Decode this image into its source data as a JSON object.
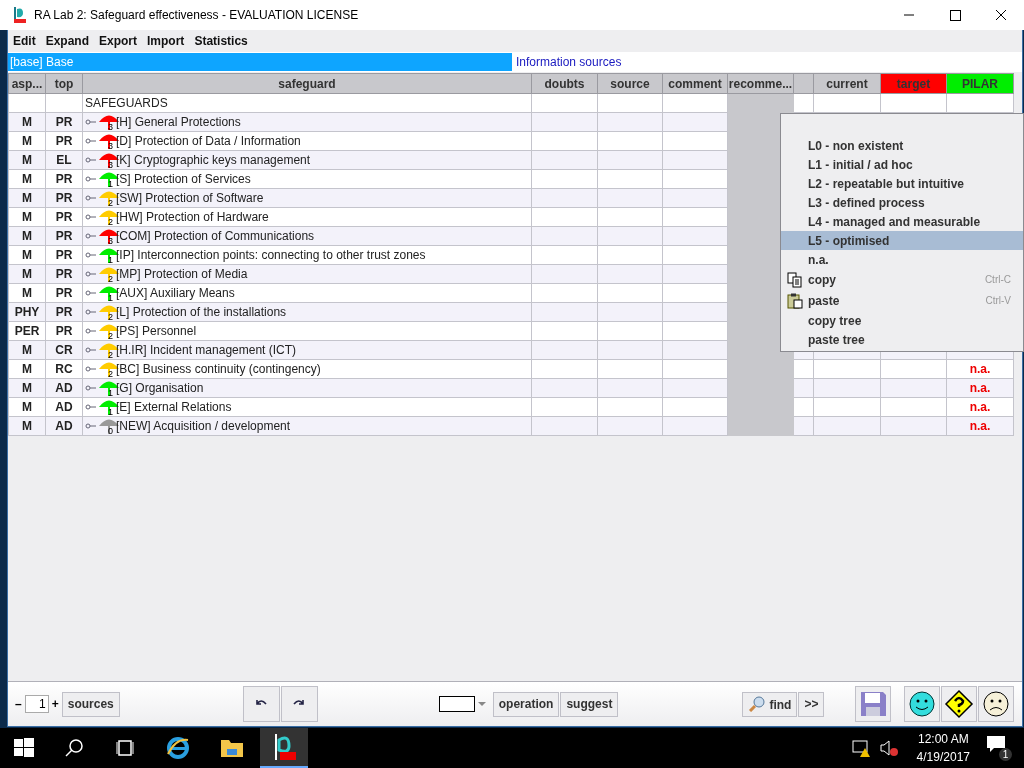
{
  "window": {
    "title": "RA Lab 2: Safeguard effectiveness - EVALUATION LICENSE"
  },
  "menu_bar": [
    "Edit",
    "Expand",
    "Export",
    "Import",
    "Statistics"
  ],
  "base_bar": {
    "base": "[base] Base",
    "sources_link": "Information sources"
  },
  "table": {
    "columns": [
      {
        "label": "asp..."
      },
      {
        "label": "top"
      },
      {
        "label": "safeguard"
      },
      {
        "label": "doubts"
      },
      {
        "label": "source"
      },
      {
        "label": "comment"
      },
      {
        "label": "recomme..."
      },
      {},
      {
        "label": "current"
      },
      {
        "label": "target",
        "color": "#ff0000"
      },
      {
        "label": "PILAR",
        "color": "#00ee00"
      }
    ],
    "root": "SAFEGUARDS",
    "rows": [
      {
        "aspect": "M",
        "top": "PR",
        "safeguard": "[H] General Protections",
        "color": "#ff0000",
        "maturity": "3"
      },
      {
        "aspect": "M",
        "top": "PR",
        "safeguard": "[D] Protection of Data / Information",
        "color": "#ff0000",
        "maturity": "3"
      },
      {
        "aspect": "M",
        "top": "EL",
        "safeguard": "[K] Cryptographic keys management",
        "color": "#ff0000",
        "maturity": "3"
      },
      {
        "aspect": "M",
        "top": "PR",
        "safeguard": "[S] Protection of Services",
        "color": "#00ee00",
        "maturity": "1"
      },
      {
        "aspect": "M",
        "top": "PR",
        "safeguard": "[SW] Protection of Software",
        "color": "#ffcc00",
        "maturity": "2"
      },
      {
        "aspect": "M",
        "top": "PR",
        "safeguard": "[HW] Protection of Hardware",
        "color": "#ffcc00",
        "maturity": "2"
      },
      {
        "aspect": "M",
        "top": "PR",
        "safeguard": "[COM] Protection of Communications",
        "color": "#ff0000",
        "maturity": "3"
      },
      {
        "aspect": "M",
        "top": "PR",
        "safeguard": "[IP] Interconnection points: connecting to other trust zones",
        "color": "#00ee00",
        "maturity": "1"
      },
      {
        "aspect": "M",
        "top": "PR",
        "safeguard": "[MP] Protection of Media",
        "color": "#ffcc00",
        "maturity": "2"
      },
      {
        "aspect": "M",
        "top": "PR",
        "safeguard": "[AUX] Auxiliary Means",
        "color": "#00ee00",
        "maturity": "1"
      },
      {
        "aspect": "PHY",
        "top": "PR",
        "safeguard": "[L] Protection of the installations",
        "color": "#ffcc00",
        "maturity": "2"
      },
      {
        "aspect": "PER",
        "top": "PR",
        "safeguard": "[PS] Personnel",
        "color": "#ffcc00",
        "maturity": "2"
      },
      {
        "aspect": "M",
        "top": "CR",
        "safeguard": "[H.IR] Incident management (ICT)",
        "color": "#ffcc00",
        "maturity": "2"
      },
      {
        "aspect": "M",
        "top": "RC",
        "safeguard": "[BC] Business continuity (contingency)",
        "color": "#ffcc00",
        "maturity": "2",
        "pilar": "n.a."
      },
      {
        "aspect": "M",
        "top": "AD",
        "safeguard": "[G] Organisation",
        "color": "#00ee00",
        "maturity": "1",
        "pilar": "n.a."
      },
      {
        "aspect": "M",
        "top": "AD",
        "safeguard": "[E] External Relations",
        "color": "#00ee00",
        "maturity": "1",
        "pilar": "n.a."
      },
      {
        "aspect": "M",
        "top": "AD",
        "safeguard": "[NEW] Acquisition / development",
        "color": "#999999",
        "maturity": "0",
        "pilar": "n.a."
      }
    ]
  },
  "context_menu": [
    {
      "kind": "option",
      "label": "L0 - non existent",
      "selected": false
    },
    {
      "kind": "option",
      "label": "L1 - initial / ad hoc",
      "selected": false
    },
    {
      "kind": "option",
      "label": "L2 - repeatable but intuitive",
      "selected": false
    },
    {
      "kind": "option",
      "label": "L3 - defined process",
      "selected": false
    },
    {
      "kind": "option",
      "label": "L4 - managed and measurable",
      "selected": false
    },
    {
      "kind": "option",
      "label": "L5 - optimised",
      "selected": true
    },
    {
      "kind": "option",
      "label": "n.a.",
      "selected": false
    },
    {
      "kind": "copy",
      "label": "copy",
      "shortcut": "Ctrl-C",
      "selected": false
    },
    {
      "kind": "paste",
      "label": "paste",
      "shortcut": "Ctrl-V",
      "selected": false
    },
    {
      "kind": "option",
      "label": "copy tree",
      "selected": false
    },
    {
      "kind": "option",
      "label": "paste tree",
      "selected": false
    }
  ],
  "toolbar": {
    "minus": "–",
    "page": "1",
    "plus": "+",
    "sources": "sources",
    "operation": "operation",
    "suggest": "suggest",
    "find": "find",
    "more": ">>"
  },
  "taskbar": {
    "time": "12:00 AM",
    "date": "4/19/2017",
    "notifications": "1"
  }
}
